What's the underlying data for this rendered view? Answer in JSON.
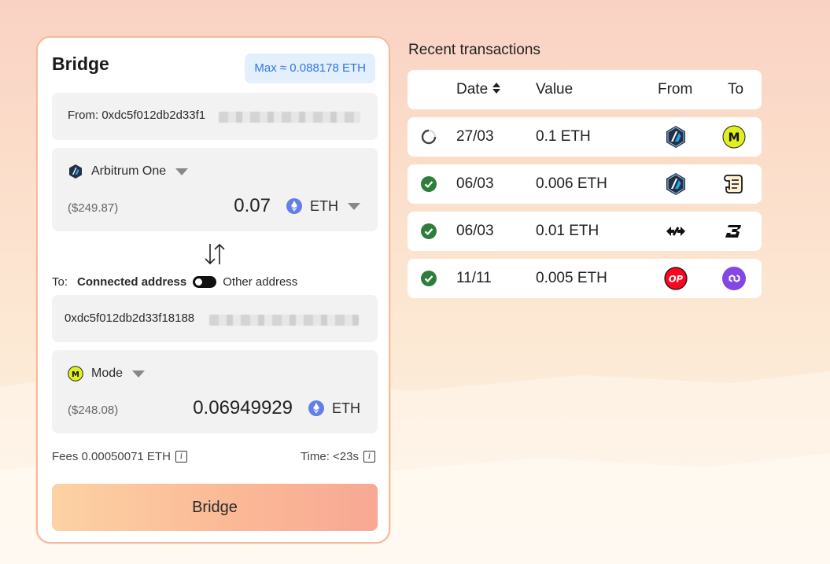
{
  "bridge": {
    "title": "Bridge",
    "max_label": "Max ≈ 0.088178 ETH",
    "from_address": "From: 0xdc5f012db2d33f1",
    "from_chain": {
      "name": "Arbitrum One",
      "usd_value": "($249.87)",
      "amount": "0.07",
      "token": "ETH"
    },
    "to_label": "To:",
    "connected_address_label": "Connected address",
    "other_address_label": "Other address",
    "to_address": "0xdc5f012db2d33f18188",
    "to_chain": {
      "name": "Mode",
      "usd_value": "($248.08)",
      "amount": "0.06949929",
      "token": "ETH"
    },
    "fees": "Fees 0.00050071 ETH",
    "time": "Time: <23s",
    "bridge_button": "Bridge"
  },
  "transactions": {
    "title": "Recent transactions",
    "headers": {
      "date": "Date",
      "value": "Value",
      "from": "From",
      "to": "To"
    },
    "rows": [
      {
        "status": "pending",
        "date": "27/03",
        "value": "0.1 ETH",
        "from_icon": "arbitrum-icon",
        "to_icon": "mode-icon",
        "to_letter": "M"
      },
      {
        "status": "done",
        "date": "06/03",
        "value": "0.006 ETH",
        "from_icon": "arbitrum-icon",
        "to_icon": "scroll-icon"
      },
      {
        "status": "done",
        "date": "06/03",
        "value": "0.01 ETH",
        "from_icon": "bridge-arrows-icon",
        "to_icon": "blast-icon"
      },
      {
        "status": "done",
        "date": "11/11",
        "value": "0.005 ETH",
        "from_icon": "optimism-icon",
        "from_letters": "OP",
        "to_icon": "polygon-icon"
      }
    ]
  },
  "colors": {
    "accent_blue": "#2a7ae2",
    "success_green": "#2f7d3c",
    "mode_yellow": "#dff01e",
    "optimism_red": "#ff0420",
    "polygon_purple": "#8247e5",
    "arbitrum_navy": "#213147",
    "eth_blue": "#627eea"
  }
}
